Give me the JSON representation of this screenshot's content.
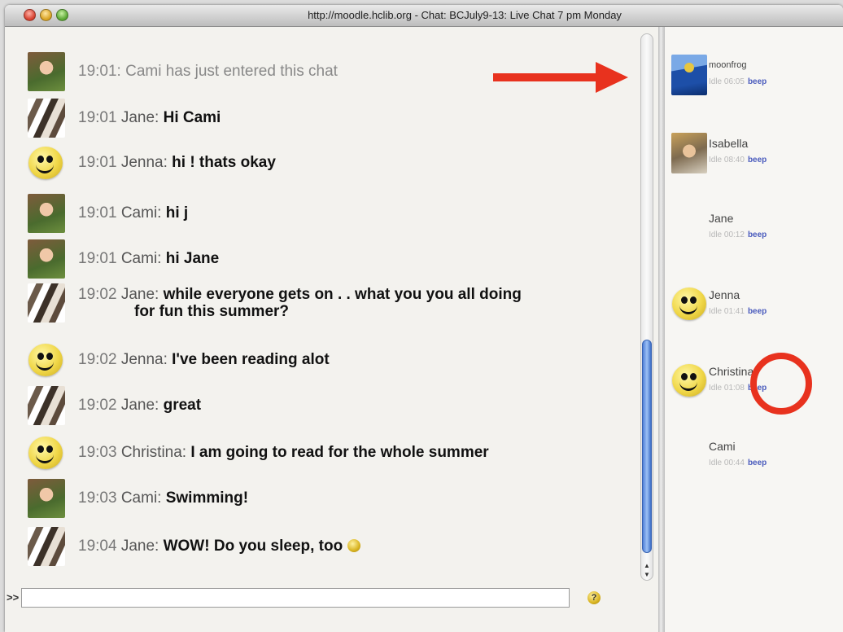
{
  "window": {
    "title": "http://moodle.hclib.org - Chat: BCJuly9-13: Live Chat 7 pm Monday"
  },
  "messages": [
    {
      "time": "19:01:",
      "who": "",
      "text": "",
      "system": "Cami has just entered this chat",
      "avatar": "cami"
    },
    {
      "time": "19:01",
      "who": "Jane:",
      "text": "Hi Cami",
      "avatar": "jane"
    },
    {
      "time": "19:01",
      "who": "Jenna:",
      "text": "hi ! thats okay",
      "avatar": "smile"
    },
    {
      "time": "19:01",
      "who": "Cami:",
      "text": "hi j",
      "avatar": "cami"
    },
    {
      "time": "19:01",
      "who": "Cami:",
      "text": "hi Jane",
      "avatar": "cami"
    },
    {
      "time": "19:02",
      "who": "Jane:",
      "text": "while everyone gets on . . what you you all doing",
      "text2": "for fun this summer?",
      "avatar": "jane"
    },
    {
      "time": "19:02",
      "who": "Jenna:",
      "text": "I've been reading alot",
      "avatar": "smile"
    },
    {
      "time": "19:02",
      "who": "Jane:",
      "text": "great",
      "avatar": "jane"
    },
    {
      "time": "19:03",
      "who": "Christina:",
      "text": "I am going to read for the whole summer",
      "avatar": "smile"
    },
    {
      "time": "19:03",
      "who": "Cami:",
      "text": "Swimming!",
      "avatar": "cami"
    },
    {
      "time": "19:04",
      "who": "Jane:",
      "text": "WOW! Do you sleep, too",
      "avatar": "jane"
    }
  ],
  "input": {
    "prompt": ">>",
    "value": "",
    "help_label": "?"
  },
  "users": [
    {
      "name": "moonfrog",
      "idle": "Idle 06:05",
      "beep": "beep",
      "avatar": "moon"
    },
    {
      "name": "Isabella",
      "idle": "Idle 08:40",
      "beep": "beep",
      "avatar": "isabella"
    },
    {
      "name": "Jane",
      "idle": "Idle 00:12",
      "beep": "beep",
      "avatar": "jane"
    },
    {
      "name": "Jenna",
      "idle": "Idle 01:41",
      "beep": "beep",
      "avatar": "smile"
    },
    {
      "name": "Christina",
      "idle": "Idle 01:08",
      "beep": "beep",
      "avatar": "smile"
    },
    {
      "name": "Cami",
      "idle": "Idle 00:44",
      "beep": "beep",
      "avatar": "cami"
    }
  ],
  "annotations": {
    "arrow_color": "#e8321e",
    "circle_color": "#e8321e"
  }
}
